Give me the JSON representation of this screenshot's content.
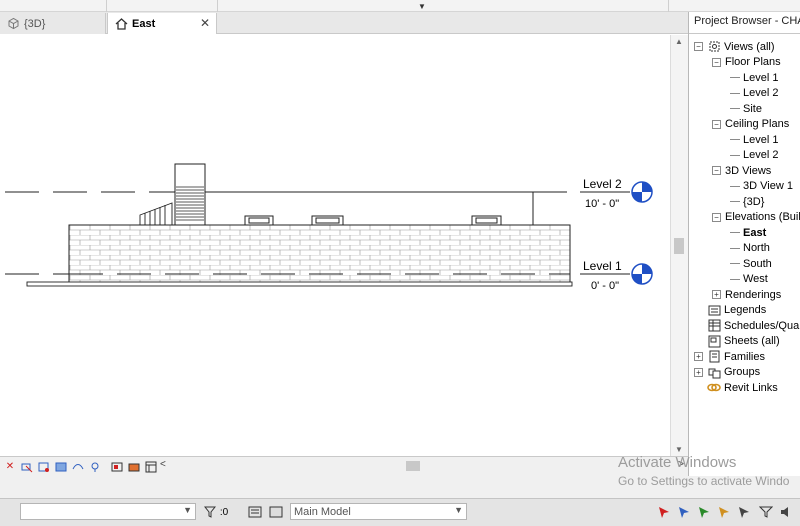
{
  "tabs": [
    {
      "label": "{3D}",
      "active": false
    },
    {
      "label": "East",
      "active": true
    }
  ],
  "levels": [
    {
      "name": "Level 2",
      "elevation": "10' - 0\""
    },
    {
      "name": "Level 1",
      "elevation": "0' - 0\""
    }
  ],
  "project_browser": {
    "title": "Project Browser - CHALL",
    "items": [
      {
        "label": "Views (all)",
        "depth": 0,
        "expander": "-",
        "icon": "views-icon"
      },
      {
        "label": "Floor Plans",
        "depth": 1,
        "expander": "-",
        "icon": ""
      },
      {
        "label": "Level 1",
        "depth": 2,
        "expander": "",
        "icon": ""
      },
      {
        "label": "Level 2",
        "depth": 2,
        "expander": "",
        "icon": ""
      },
      {
        "label": "Site",
        "depth": 2,
        "expander": "",
        "icon": ""
      },
      {
        "label": "Ceiling Plans",
        "depth": 1,
        "expander": "-",
        "icon": ""
      },
      {
        "label": "Level 1",
        "depth": 2,
        "expander": "",
        "icon": ""
      },
      {
        "label": "Level 2",
        "depth": 2,
        "expander": "",
        "icon": ""
      },
      {
        "label": "3D Views",
        "depth": 1,
        "expander": "-",
        "icon": ""
      },
      {
        "label": "3D View 1",
        "depth": 2,
        "expander": "",
        "icon": ""
      },
      {
        "label": "{3D}",
        "depth": 2,
        "expander": "",
        "icon": ""
      },
      {
        "label": "Elevations (Build",
        "depth": 1,
        "expander": "-",
        "icon": ""
      },
      {
        "label": "East",
        "depth": 2,
        "expander": "",
        "icon": "",
        "selected": true
      },
      {
        "label": "North",
        "depth": 2,
        "expander": "",
        "icon": ""
      },
      {
        "label": "South",
        "depth": 2,
        "expander": "",
        "icon": ""
      },
      {
        "label": "West",
        "depth": 2,
        "expander": "",
        "icon": ""
      },
      {
        "label": "Renderings",
        "depth": 1,
        "expander": "+",
        "icon": ""
      },
      {
        "label": "Legends",
        "depth": 0,
        "expander": "",
        "icon": "legends-icon"
      },
      {
        "label": "Schedules/Quan",
        "depth": 0,
        "expander": "",
        "icon": "schedules-icon"
      },
      {
        "label": "Sheets (all)",
        "depth": 0,
        "expander": "",
        "icon": "sheets-icon"
      },
      {
        "label": "Families",
        "depth": 0,
        "expander": "+",
        "icon": "families-icon"
      },
      {
        "label": "Groups",
        "depth": 0,
        "expander": "+",
        "icon": "groups-icon"
      },
      {
        "label": "Revit Links",
        "depth": 0,
        "expander": "",
        "icon": "revit-links-icon"
      }
    ]
  },
  "status_bar": {
    "workset_value": "",
    "count": ":0",
    "model_value": "Main Model"
  },
  "watermark": {
    "line1": "Activate Windows",
    "line2": "Go to Settings to activate Windo"
  },
  "colors": {
    "level_head": "#1f4fc4",
    "selected_text": "#000000"
  }
}
